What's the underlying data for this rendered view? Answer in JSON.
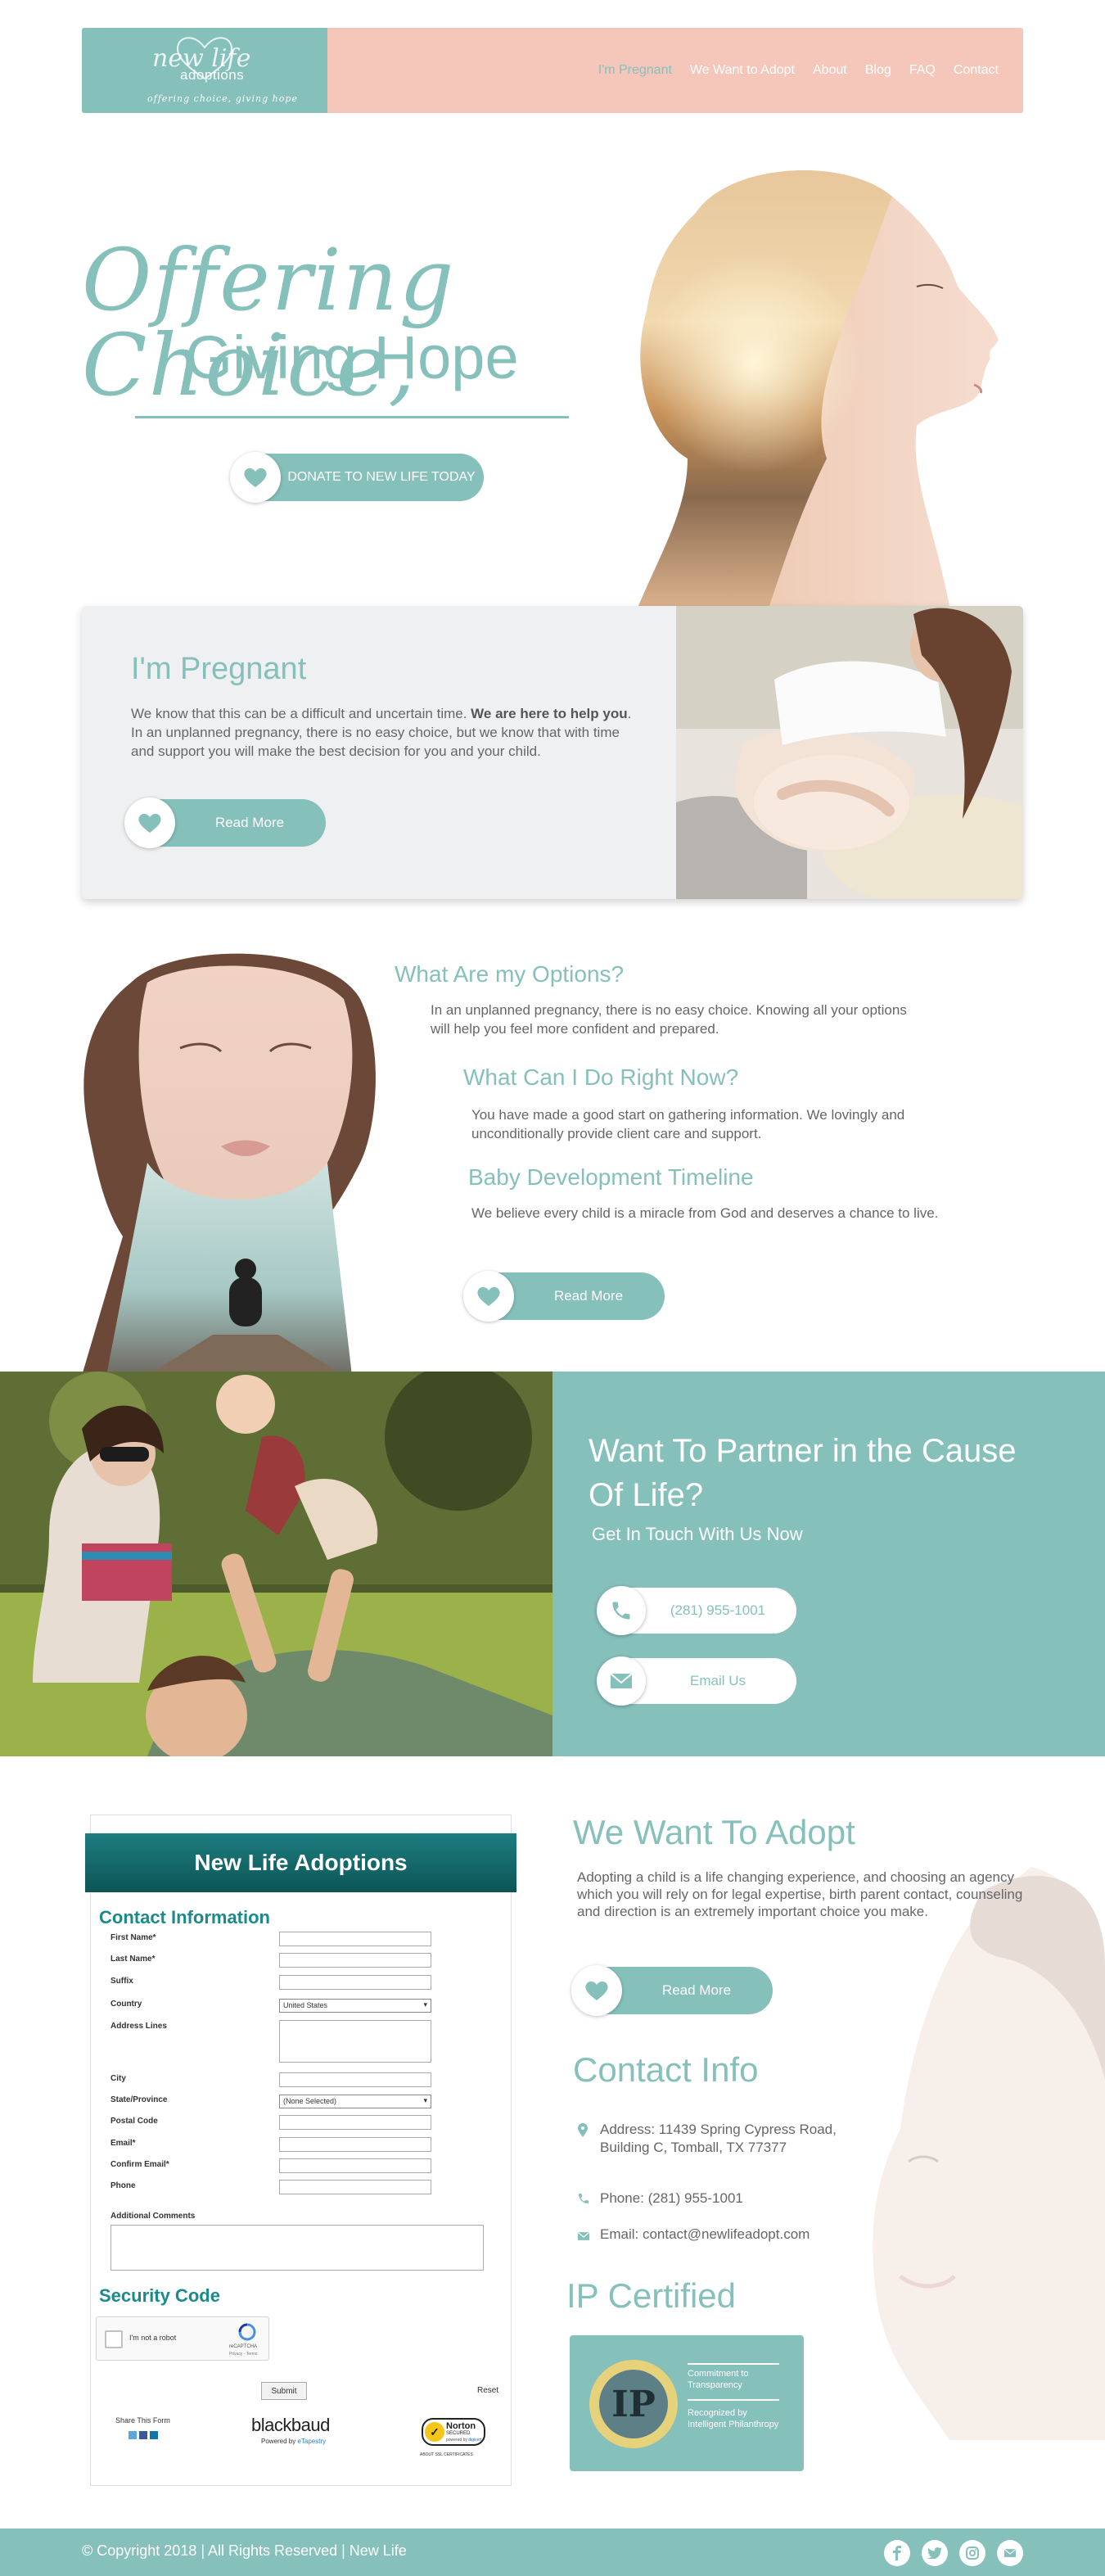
{
  "header": {
    "logo_script": "new life",
    "logo_word": "adoptions",
    "logo_tag": "offering choice, giving hope",
    "nav": [
      "I'm Pregnant",
      "We Want to Adopt",
      "About",
      "Blog",
      "FAQ",
      "Contact"
    ]
  },
  "hero": {
    "title_line1": "Offering Choice,",
    "title_line2": "Giving Hope",
    "donate_label": "DONATE TO NEW LIFE TODAY"
  },
  "pregnant": {
    "title": "I'm Pregnant",
    "text_before": "We know that this can be a difficult and uncertain time. ",
    "text_bold": "We are here to help you",
    "text_after": ". In an unplanned pregnancy, there is no easy choice, but we know that with time and support you will make the best decision for you and your child.",
    "button": "Read More"
  },
  "options": {
    "title": "What Are my Options?",
    "text": "In an unplanned pregnancy, there is no easy choice. Knowing all your options will help you feel more confident and prepared.",
    "now_title": "What Can I Do Right Now?",
    "now_text": "You have made a good start on gathering information. We lovingly and unconditionally provide client care and support.",
    "timeline_title": "Baby Development Timeline",
    "timeline_text": "We believe every child is a miracle from God and deserves a chance to live.",
    "button": "Read More"
  },
  "partner": {
    "title": "Want To Partner in the Cause Of Life?",
    "subtitle": "Get In Touch With Us Now",
    "phone": "(281) 955-1001",
    "email_label": "Email Us"
  },
  "form": {
    "title": "New Life Adoptions",
    "section_contact": "Contact Information",
    "fields": [
      "First Name*",
      "Last Name*",
      "Suffix",
      "Country",
      "Address Lines",
      "City",
      "State/Province",
      "Postal Code",
      "Email*",
      "Confirm Email*",
      "Phone"
    ],
    "country_value": "United States",
    "state_value": "(None Selected)",
    "comments_label": "Additional Comments",
    "section_security": "Security Code",
    "captcha_label": "I'm not a robot",
    "captcha_brand": "reCAPTCHA",
    "captcha_terms": "Privacy - Terms",
    "submit": "Submit",
    "reset": "Reset",
    "share": "Share This Form",
    "blackbaud": "blackbaud",
    "powered": "Powered by ",
    "powered_link": "eTapestry",
    "norton": "Norton",
    "norton_sub": "SECURED",
    "norton_powered": "powered by",
    "norton_digicert": "digicert",
    "norton_about": "ABOUT SSL CERTIFICATES"
  },
  "adopt": {
    "title": "We Want To Adopt",
    "text": "Adopting a child is a life changing experience, and choosing an agency which you will rely on for legal expertise, birth parent contact, counseling and direction is an extremely important choice you make.",
    "button": "Read More"
  },
  "contact": {
    "title": "Contact Info",
    "address": "Address: 11439 Spring Cypress Road, Building C, Tomball, TX 77377",
    "phone": "Phone: (281) 955-1001",
    "email": "Email: contact@newlifeadopt.com"
  },
  "ip": {
    "title": "IP Certified",
    "badge_logo": "IP",
    "badge_line1": "Commitment to Transparency",
    "badge_line2": "Recognized by Intelligent Philanthropy"
  },
  "footer": {
    "copyright": "© Copyright 2018 | All Rights Reserved | New Life"
  },
  "colors": {
    "teal": "#86c0bb",
    "peach": "#f4c7ba",
    "form_teal": "#1a8a8c"
  }
}
